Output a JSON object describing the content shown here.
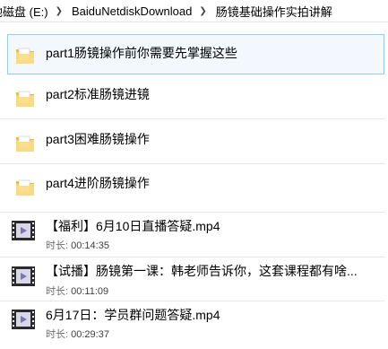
{
  "breadcrumb": {
    "items": [
      "地磁盘 (E:)",
      "BaiduNetdiskDownload",
      "肠镜基础操作实拍讲解"
    ]
  },
  "folders": [
    {
      "name": "part1肠镜操作前你需要先掌握这些",
      "selected": true
    },
    {
      "name": "part2标准肠镜进镜",
      "selected": false
    },
    {
      "name": "part3困难肠镜操作",
      "selected": false
    },
    {
      "name": "part4进阶肠镜操作",
      "selected": false
    }
  ],
  "videos": [
    {
      "name": "【福利】6月10日直播答疑.mp4",
      "duration_label": "时长:",
      "duration": "00:14:35"
    },
    {
      "name": "【试播】肠镜第一课：韩老师告诉你，这套课程都有啥...",
      "duration_label": "时长:",
      "duration": "00:11:09"
    },
    {
      "name": "6月17日：学员群问题答疑.mp4",
      "duration_label": "时长:",
      "duration": "00:29:37"
    }
  ],
  "colors": {
    "folder": "#f7d776",
    "selection_border": "#99c9ef",
    "selection_fill": "#f2f8fd"
  },
  "icons": {
    "folder": "folder-icon",
    "video": "video-file-icon"
  }
}
